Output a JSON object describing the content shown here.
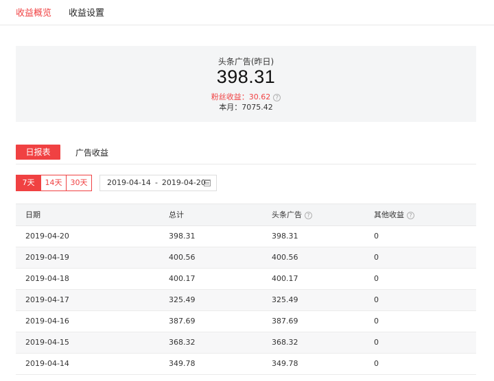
{
  "top_tabs": [
    "收益概览",
    "收益设置"
  ],
  "summary": {
    "label": "头条广告(昨日)",
    "value": "398.31",
    "fans_income": "粉丝收益：30.62",
    "this_month": "本月：7075.42"
  },
  "sub_tabs": [
    "日报表",
    "广告收益"
  ],
  "range_buttons": [
    "7天",
    "14天",
    "30天"
  ],
  "date_range": {
    "start": "2019-04-14",
    "sep": "-",
    "end": "2019-04-20"
  },
  "table": {
    "headers": [
      "日期",
      "总计",
      "头条广告",
      "其他收益"
    ],
    "rows": [
      [
        "2019-04-20",
        "398.31",
        "398.31",
        "0"
      ],
      [
        "2019-04-19",
        "400.56",
        "400.56",
        "0"
      ],
      [
        "2019-04-18",
        "400.17",
        "400.17",
        "0"
      ],
      [
        "2019-04-17",
        "325.49",
        "325.49",
        "0"
      ],
      [
        "2019-04-16",
        "387.69",
        "387.69",
        "0"
      ],
      [
        "2019-04-15",
        "368.32",
        "368.32",
        "0"
      ],
      [
        "2019-04-14",
        "349.78",
        "349.78",
        "0"
      ]
    ]
  },
  "colors": {
    "accent": "#f04142",
    "panel_bg": "#f4f5f6"
  }
}
